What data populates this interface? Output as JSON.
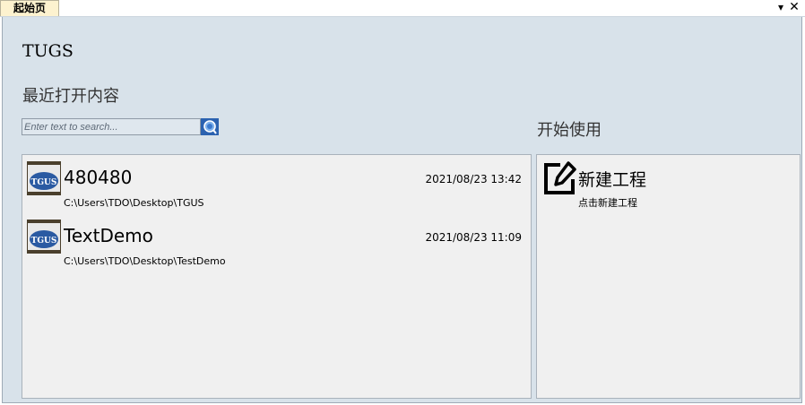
{
  "tab": {
    "label": "起始页",
    "pin_icon": "▾",
    "close_icon": "✕"
  },
  "app_title": "TUGS",
  "recent": {
    "heading": "最近打开内容",
    "search_placeholder": "Enter text to search...",
    "items": [
      {
        "name": "480480",
        "date": "2021/08/23 13:42",
        "path": "C:\\Users\\TDO\\Desktop\\TGUS",
        "thumb_text": "TGUS"
      },
      {
        "name": "TextDemo",
        "date": "2021/08/23 11:09",
        "path": "C:\\Users\\TDO\\Desktop\\TestDemo",
        "thumb_text": "TGUS"
      }
    ]
  },
  "start": {
    "heading": "开始使用",
    "new_project": {
      "title": "新建工程",
      "desc": "点击新建工程"
    }
  },
  "colors": {
    "content_bg": "#d8e2ea",
    "panel_bg": "#f0f0f0",
    "tab_bg": "#fdf2cf",
    "search_button": "#2b62b0"
  }
}
